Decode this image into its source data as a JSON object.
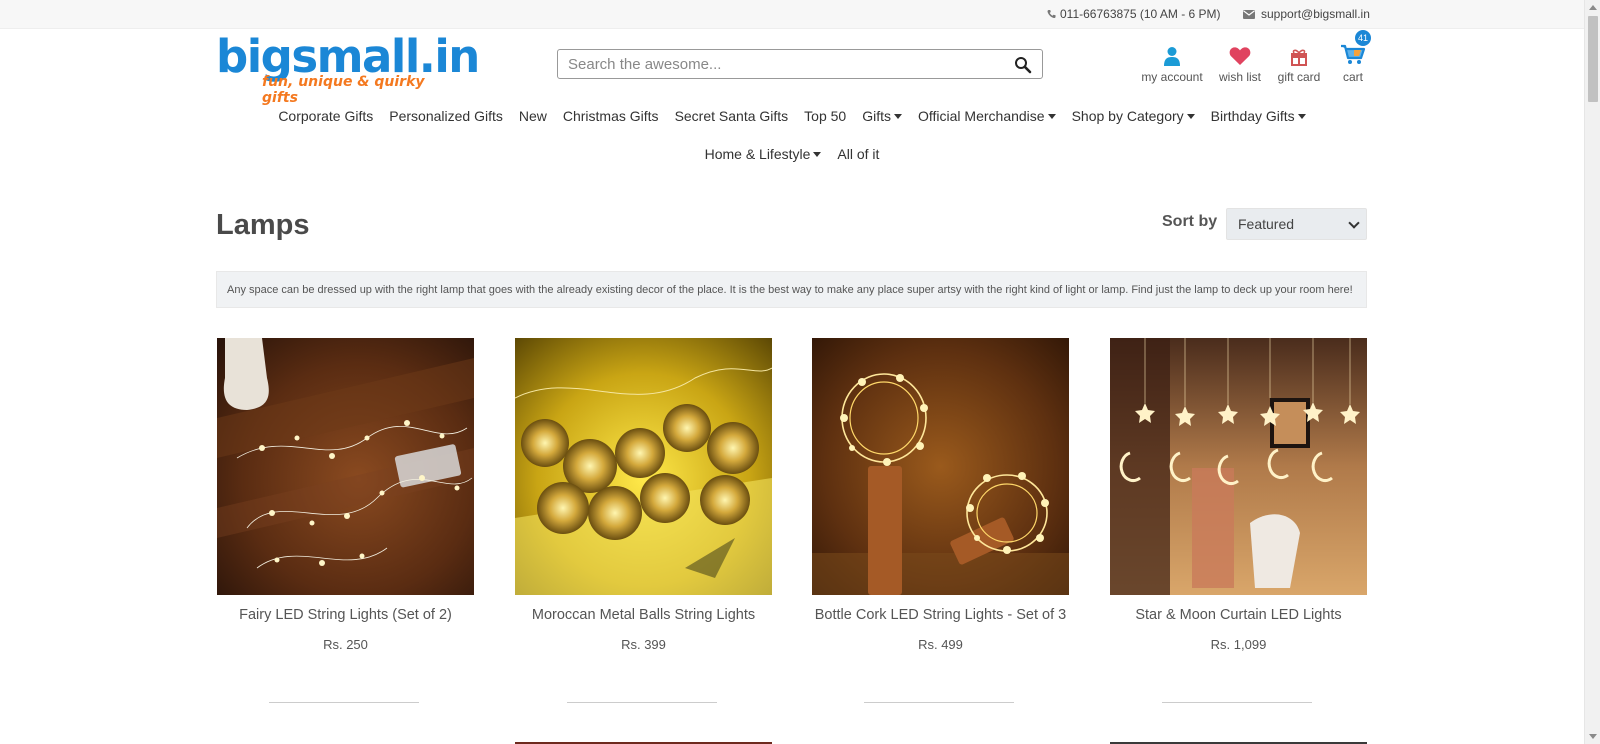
{
  "topbar": {
    "phone": "011-66763875 (10 AM - 6 PM)",
    "email": "support@bigsmall.in",
    "icons": [
      "phone-icon",
      "envelope-icon"
    ]
  },
  "logo": {
    "word": "bigsmall.in",
    "tagline": "fun, unique & quirky gifts"
  },
  "search": {
    "placeholder": "Search the awesome...",
    "value": ""
  },
  "account_links": [
    {
      "label": "my account",
      "icon": "user-icon"
    },
    {
      "label": "wish list",
      "icon": "heart-icon"
    },
    {
      "label": "gift card",
      "icon": "gift-icon"
    },
    {
      "label": "cart",
      "icon": "cart-icon",
      "count": "41"
    }
  ],
  "nav": {
    "row1": [
      {
        "label": "Corporate Gifts",
        "dropdown": false
      },
      {
        "label": "Personalized Gifts",
        "dropdown": false
      },
      {
        "label": "New",
        "dropdown": false
      },
      {
        "label": "Christmas Gifts",
        "dropdown": false
      },
      {
        "label": "Secret Santa Gifts",
        "dropdown": false
      },
      {
        "label": "Top 50",
        "dropdown": false
      },
      {
        "label": "Gifts",
        "dropdown": true
      },
      {
        "label": "Official Merchandise",
        "dropdown": true
      },
      {
        "label": "Shop by Category",
        "dropdown": true
      },
      {
        "label": "Birthday Gifts",
        "dropdown": true
      }
    ],
    "row2": [
      {
        "label": "Home & Lifestyle",
        "dropdown": true
      },
      {
        "label": "All of it",
        "dropdown": false
      }
    ]
  },
  "page": {
    "title": "Lamps",
    "sort_label": "Sort by",
    "sort_selected": "Featured",
    "description": "Any space can be dressed up with the right lamp that goes with the already existing decor of the place. It is the best way to make any place super artsy with the right kind of light or lamp. Find just the lamp to deck up your room here!"
  },
  "products": [
    {
      "name": "Fairy LED String Lights (Set of 2)",
      "price": "Rs. 250"
    },
    {
      "name": "Moroccan Metal Balls String Lights",
      "price": "Rs. 399"
    },
    {
      "name": "Bottle Cork LED String Lights - Set of 3",
      "price": "Rs. 499"
    },
    {
      "name": "Star & Moon Curtain LED Lights",
      "price": "Rs. 1,099"
    }
  ],
  "colors": {
    "brand_blue": "#1b87d6",
    "brand_orange": "#f47920",
    "heart": "#e0435f",
    "gift": "#d05454"
  }
}
